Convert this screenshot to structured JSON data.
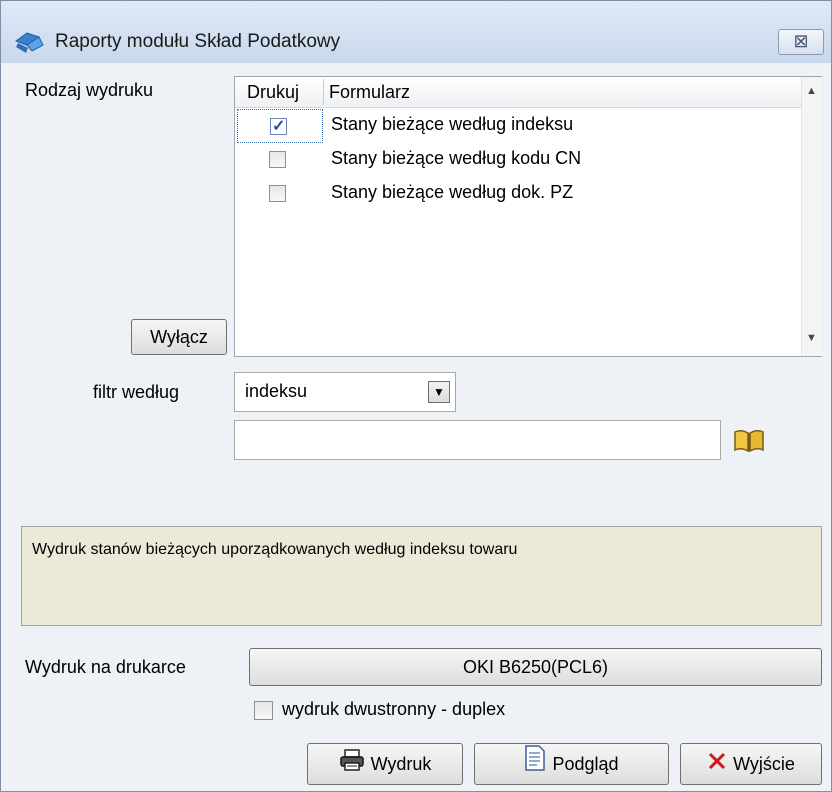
{
  "window": {
    "title": "Raporty modułu Skład Podatkowy",
    "close_label": "⊠"
  },
  "report_type": {
    "label": "Rodzaj wydruku",
    "columns": [
      "Drukuj",
      "Formularz"
    ],
    "rows": [
      {
        "checked": true,
        "name": "Stany bieżące według indeksu"
      },
      {
        "checked": false,
        "name": "Stany bieżące według kodu CN"
      },
      {
        "checked": false,
        "name": "Stany bieżące według dok. PZ"
      }
    ],
    "toggle_button": "Wyłącz"
  },
  "filter": {
    "label": "filtr według",
    "selected": "indeksu",
    "value": ""
  },
  "description": "Wydruk stanów bieżących uporządkowanych według indeksu towaru",
  "printer": {
    "label": "Wydruk na drukarce",
    "name": "OKI B6250(PCL6)",
    "duplex_label": "wydruk dwustronny - duplex",
    "duplex_checked": false
  },
  "actions": {
    "print": "Wydruk",
    "preview": "Podgląd",
    "exit": "Wyjście"
  },
  "colors": {
    "window_bg": "#eef1f5",
    "description_bg": "#ece9d8",
    "exit_icon": "#d01818"
  },
  "icons": {
    "app": "app-icon",
    "close": "close-icon",
    "book": "book-icon",
    "printer": "printer-icon",
    "preview": "document-preview-icon",
    "exit": "x-icon"
  }
}
